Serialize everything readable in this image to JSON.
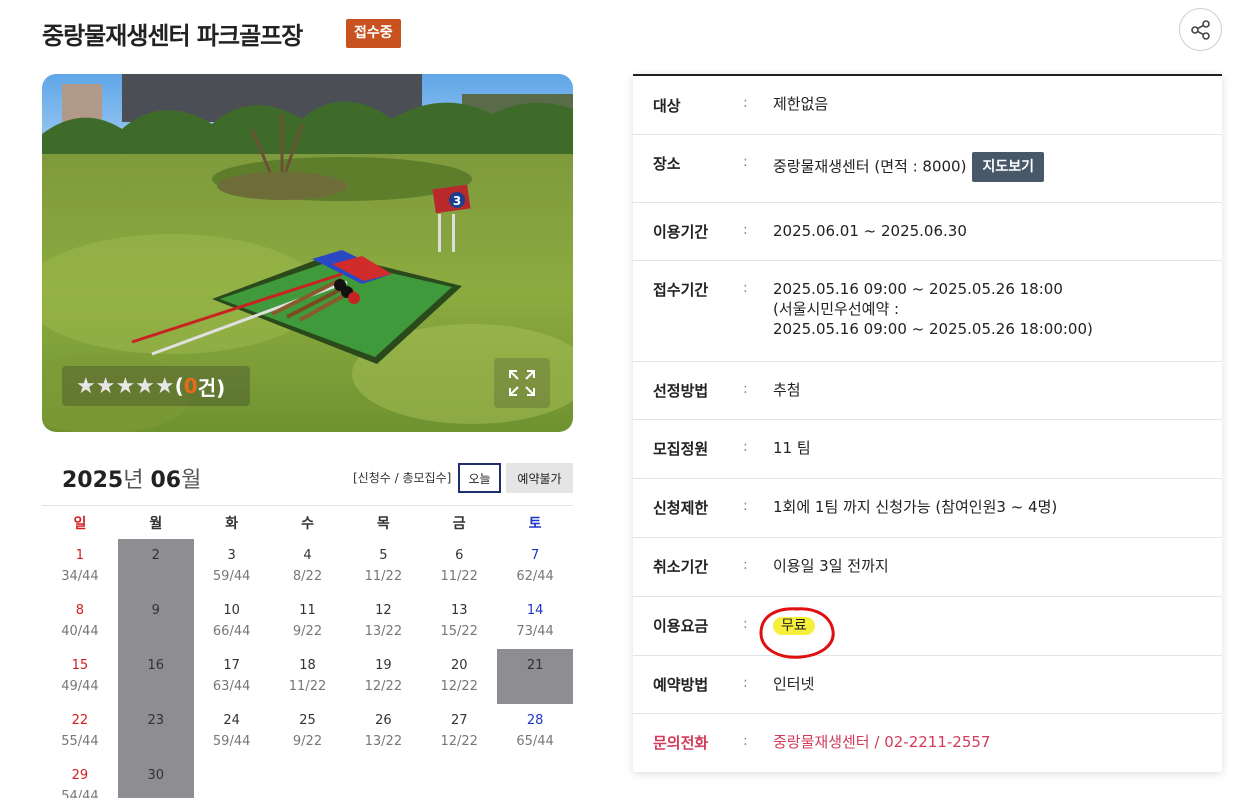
{
  "header": {
    "title": "중랑물재생센터 파크골프장",
    "status_badge": "접수중"
  },
  "photo": {
    "rating_stars": "★★★★★",
    "rating_open": "(",
    "rating_count": "0",
    "rating_close": " 건)",
    "flag_number": "3",
    "mat_label": "3 3"
  },
  "calendar": {
    "year": "2025",
    "year_unit": "년 ",
    "month": "06",
    "month_unit": "월",
    "legend_text": "[신청수 / 총모집수]",
    "today_label": "오늘",
    "unavailable_label": "예약불가",
    "weekdays": [
      "일",
      "월",
      "화",
      "수",
      "목",
      "금",
      "토"
    ],
    "weeks": [
      [
        {
          "day": "1",
          "count": "34/44"
        },
        {
          "day": "2",
          "count": "",
          "closed": true
        },
        {
          "day": "3",
          "count": "59/44"
        },
        {
          "day": "4",
          "count": "8/22"
        },
        {
          "day": "5",
          "count": "11/22"
        },
        {
          "day": "6",
          "count": "11/22"
        },
        {
          "day": "7",
          "count": "62/44"
        }
      ],
      [
        {
          "day": "8",
          "count": "40/44"
        },
        {
          "day": "9",
          "count": "",
          "closed": true
        },
        {
          "day": "10",
          "count": "66/44"
        },
        {
          "day": "11",
          "count": "9/22"
        },
        {
          "day": "12",
          "count": "13/22"
        },
        {
          "day": "13",
          "count": "15/22"
        },
        {
          "day": "14",
          "count": "73/44"
        }
      ],
      [
        {
          "day": "15",
          "count": "49/44"
        },
        {
          "day": "16",
          "count": "",
          "closed": true
        },
        {
          "day": "17",
          "count": "63/44"
        },
        {
          "day": "18",
          "count": "11/22"
        },
        {
          "day": "19",
          "count": "12/22"
        },
        {
          "day": "20",
          "count": "12/22"
        },
        {
          "day": "21",
          "count": "",
          "closed": true
        }
      ],
      [
        {
          "day": "22",
          "count": "55/44"
        },
        {
          "day": "23",
          "count": "",
          "closed": true
        },
        {
          "day": "24",
          "count": "59/44"
        },
        {
          "day": "25",
          "count": "9/22"
        },
        {
          "day": "26",
          "count": "13/22"
        },
        {
          "day": "27",
          "count": "12/22"
        },
        {
          "day": "28",
          "count": "65/44"
        }
      ],
      [
        {
          "day": "29",
          "count": "54/44"
        },
        {
          "day": "30",
          "count": "",
          "closed": true
        },
        null,
        null,
        null,
        null,
        null
      ]
    ]
  },
  "info": {
    "colon": ":",
    "target_label": "대상",
    "target_value": "제한없음",
    "location_label": "장소",
    "location_value": "중랑물재생센터 (면적 : 8000)",
    "map_button": "지도보기",
    "period_label": "이용기간",
    "period_value": "2025.06.01 ~ 2025.06.30",
    "reception_label": "접수기간",
    "reception_line1": "2025.05.16 09:00 ~ 2025.05.26 18:00",
    "reception_line2": "(서울시민우선예약 :",
    "reception_line3": "2025.05.16 09:00 ~ 2025.05.26 18:00:00)",
    "selection_label": "선정방법",
    "selection_value": "추첨",
    "capacity_label": "모집정원",
    "capacity_value": "11 팀",
    "limit_label": "신청제한",
    "limit_value": "1회에 1팀 까지 신청가능 (참여인원3 ~ 4명)",
    "cancel_label": "취소기간",
    "cancel_value": "이용일 3일 전까지",
    "fee_label": "이용요금",
    "fee_value": "무료",
    "method_label": "예약방법",
    "method_value": "인터넷",
    "contact_label": "문의전화",
    "contact_value": "중랑물재생센터 / 02-2211-2557"
  },
  "colors": {
    "badge": "#c8521e",
    "sunday": "#d21e1e",
    "saturday": "#1e37c8",
    "closed_cell": "#8d8d92",
    "map_button": "#475868",
    "contact": "#d23c5a",
    "highlight": "#f6ef3c",
    "annotation_circle": "#e01010"
  },
  "icons": {
    "share": "share-icon",
    "expand": "expand-icon"
  }
}
